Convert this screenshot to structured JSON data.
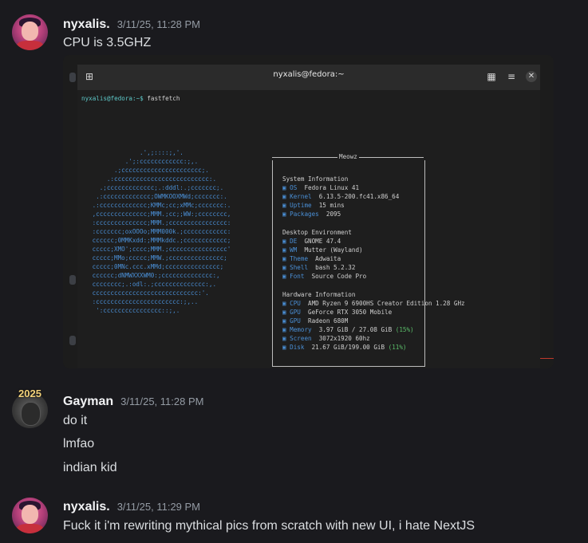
{
  "messages": [
    {
      "username": "nyxalis.",
      "timestamp": "3/11/25, 11:28 PM",
      "lines": [
        "CPU is 3.5GHZ"
      ]
    },
    {
      "username": "Gayman",
      "timestamp": "3/11/25, 11:28 PM",
      "lines": [
        "do it",
        "lmfao",
        "indian kid"
      ],
      "avatar_badge": "2025"
    },
    {
      "username": "nyxalis.",
      "timestamp": "3/11/25, 11:29 PM",
      "lines": [
        "Fuck it i'm rewriting mythical pics from scratch with new UI, i hate NextJS"
      ]
    }
  ],
  "terminal": {
    "title": "nyxalis@fedora:~",
    "prompt": "nyxalis@fedora:~$ ",
    "command": "fastfetch",
    "icons": {
      "new_tab": "new-tab-icon",
      "grid": "grid-icon",
      "menu": "menu-icon",
      "close": "close-icon"
    },
    "box_title": "Meowz",
    "system_header": "System Information",
    "system": [
      {
        "key": "OS",
        "value": "Fedora Linux 41"
      },
      {
        "key": "Kernel",
        "value": "6.13.5-200.fc41.x86_64"
      },
      {
        "key": "Uptime",
        "value": "15 mins"
      },
      {
        "key": "Packages",
        "value": "2095"
      }
    ],
    "desktop_header": "Desktop Environment",
    "desktop": [
      {
        "key": "DE",
        "value": "GNOME 47.4"
      },
      {
        "key": "WM",
        "value": "Mutter (Wayland)"
      },
      {
        "key": "Theme",
        "value": "Adwaita"
      },
      {
        "key": "Shell",
        "value": "bash 5.2.32"
      },
      {
        "key": "Font",
        "value": "Source Code Pro"
      }
    ],
    "hardware_header": "Hardware Information",
    "hardware": [
      {
        "key": "CPU",
        "value": "AMD Ryzen 9 6900HS Creator Edition 1.28 GHz"
      },
      {
        "key": "GPU",
        "value": "GeForce RTX 3050 Mobile"
      },
      {
        "key": "GPU",
        "value": "Radeon 680M"
      },
      {
        "key": "Memory",
        "value": "3.97 GiB / 27.08 GiB",
        "pct": "(15%)"
      },
      {
        "key": "Screen",
        "value": "3072x1920 60hz"
      },
      {
        "key": "Disk",
        "value": "21.67 GiB/199.00 GiB",
        "pct": "(11%)"
      }
    ],
    "ascii": [
      "              .',;::::;,'.",
      "          .';:cccccccccccc:;,.",
      "       .;cccccccccccccccccccccc;.",
      "     .:cccccccccccccccccccccccccc:.",
      "   .;ccccccccccccc;.:dddl:.;ccccccc;.",
      "  .:ccccccccccccc;OWMKOOXMWd;ccccccc:.",
      " .:ccccccccccccc;KMMc;cc;xMMc;ccccccc:.",
      " ,cccccccccccccc;MMM.;cc;;WW:;cccccccc,",
      " :cccccccccccccc;MMM.;cccccccccccccccc:",
      " :ccccccc;oxOOOo;MMM000k.;cccccccccccc:",
      " cccccc;0MMKxdd:;MMMkddc.;cccccccccccc;",
      " ccccc;XMO';cccc;MMM.;cccccccccccccccc'",
      " ccccc;MMo;ccccc;MMW.;ccccccccccccccc;",
      " ccccc;0MNc.ccc.xMMd;ccccccccccccccc;",
      " cccccc;dNMWXXXWM0:;cccccccccccccc:,",
      " cccccccc;.:odl:.;cccccccccccccc:,.",
      " ccccccccccccccccccccccccccccc:'.",
      " :ccccccccccccccccccccccc:;,..",
      "  ':cccccccccccccccc::;,."
    ]
  }
}
